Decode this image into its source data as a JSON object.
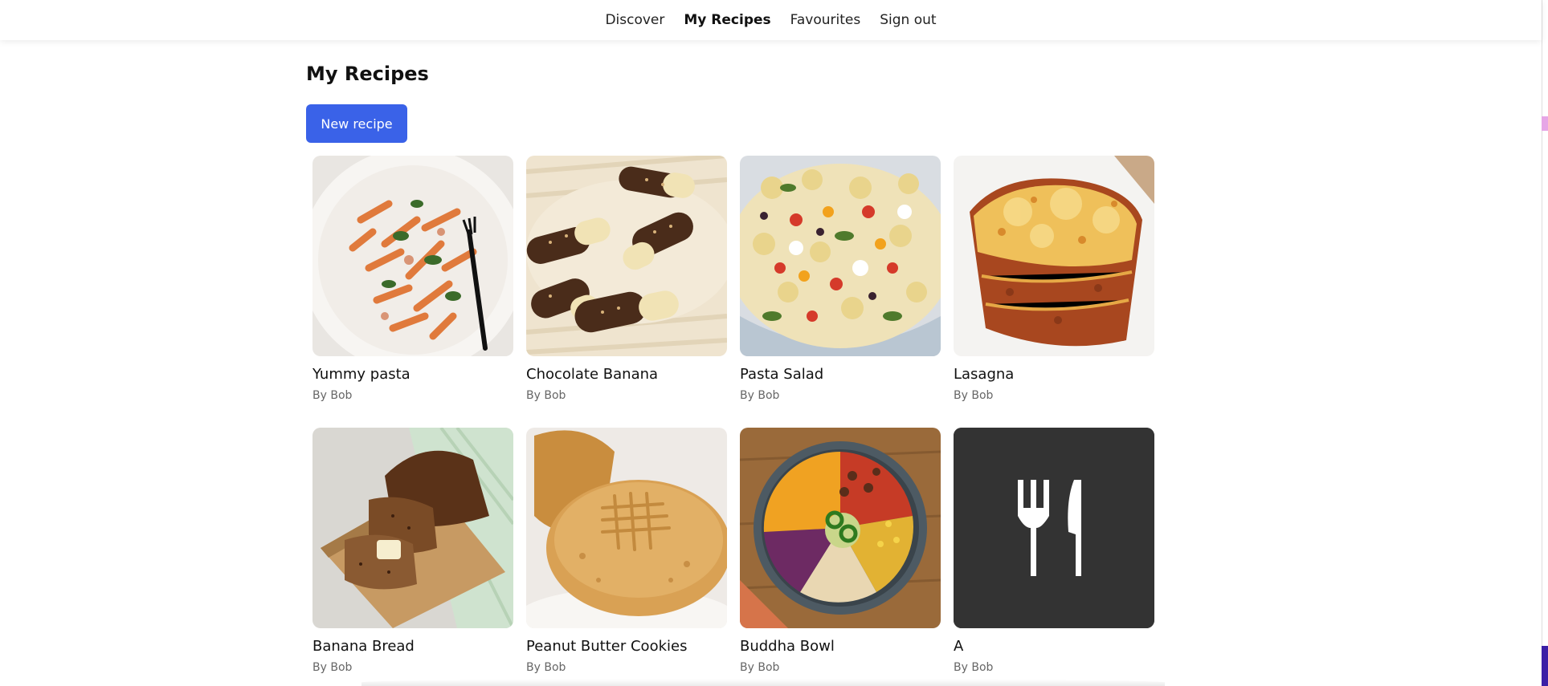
{
  "nav": {
    "items": [
      {
        "label": "Discover",
        "active": false
      },
      {
        "label": "My Recipes",
        "active": true
      },
      {
        "label": "Favourites",
        "active": false
      },
      {
        "label": "Sign out",
        "active": false
      }
    ]
  },
  "page": {
    "title": "My Recipes",
    "new_button_label": "New recipe",
    "accent_color": "#3a62e8"
  },
  "recipes": [
    {
      "title": "Yummy pasta",
      "author": "By Bob",
      "image": "penne-pasta-image"
    },
    {
      "title": "Chocolate Banana",
      "author": "By Bob",
      "image": "chocolate-banana-image"
    },
    {
      "title": "Pasta Salad",
      "author": "By Bob",
      "image": "pasta-salad-image"
    },
    {
      "title": "Lasagna",
      "author": "By Bob",
      "image": "lasagna-image"
    },
    {
      "title": "Banana Bread",
      "author": "By Bob",
      "image": "banana-bread-image"
    },
    {
      "title": "Peanut Butter Cookies",
      "author": "By Bob",
      "image": "peanut-butter-cookie-image"
    },
    {
      "title": "Buddha Bowl",
      "author": "By Bob",
      "image": "buddha-bowl-image"
    },
    {
      "title": "A",
      "author": "By Bob",
      "image": "fork-knife-icon"
    }
  ]
}
